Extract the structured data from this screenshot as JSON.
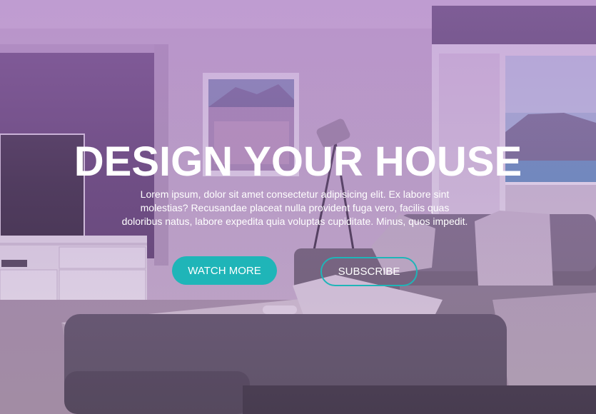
{
  "hero": {
    "title": "DESIGN YOUR HOUSE",
    "description": "Lorem ipsum, dolor sit amet consectetur adipisicing elit. Ex labore sint molestias? Recusandae placeat nulla provident fuga vero, facilis quas doloribus natus, labore expedita quia voluptas cupiditate. Minus, quos impedit.",
    "watch_button": "WATCH MORE",
    "subscribe_button": "SUBSCRIBE",
    "background_image": "living-room-photo"
  },
  "colors": {
    "accent": "#1fb5b8",
    "overlay": "#a978c8",
    "text": "#ffffff"
  }
}
